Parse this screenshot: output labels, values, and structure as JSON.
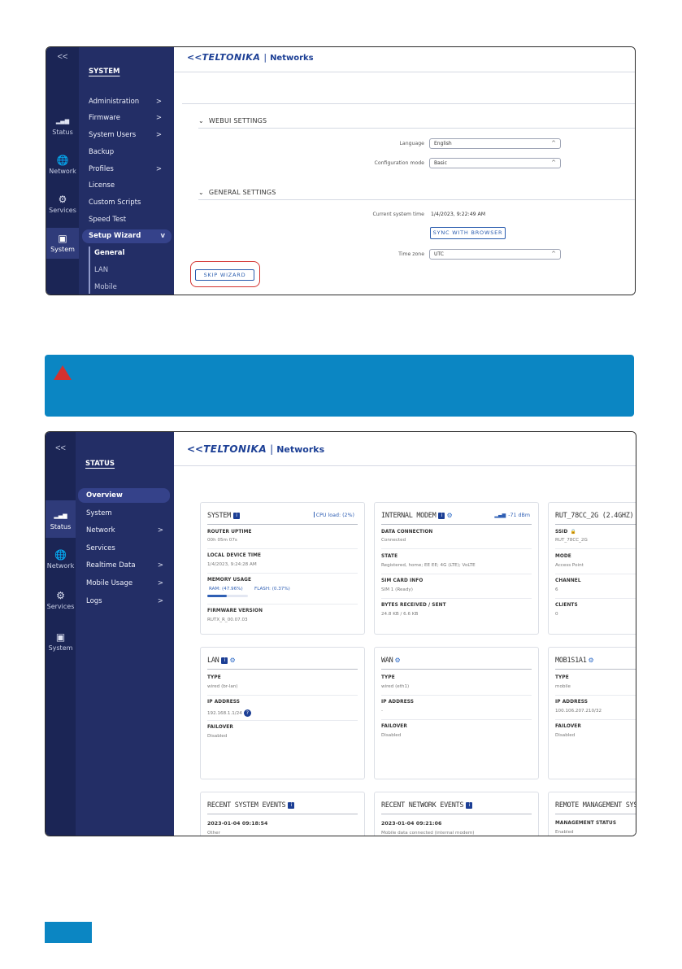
{
  "wizard": {
    "collapse": "<<",
    "icon_sidebar": [
      {
        "label": "Status",
        "icon": "signal-icon",
        "glyph": "▂▄▆"
      },
      {
        "label": "Network",
        "icon": "globe-icon",
        "glyph": "🌐"
      },
      {
        "label": "Services",
        "icon": "gear-icon",
        "glyph": "⚙"
      },
      {
        "label": "System",
        "icon": "system-icon",
        "glyph": "▣"
      }
    ],
    "nav_title": "SYSTEM",
    "nav_items": [
      {
        "label": "Administration",
        "has_arrow": true
      },
      {
        "label": "Firmware",
        "has_arrow": true
      },
      {
        "label": "System Users",
        "has_arrow": true
      },
      {
        "label": "Backup",
        "has_arrow": false
      },
      {
        "label": "Profiles",
        "has_arrow": true
      },
      {
        "label": "License",
        "has_arrow": false
      },
      {
        "label": "Custom Scripts",
        "has_arrow": false
      },
      {
        "label": "Speed Test",
        "has_arrow": false
      },
      {
        "label": "Setup Wizard",
        "has_arrow": true
      }
    ],
    "sub_items": [
      "General",
      "LAN",
      "Mobile"
    ],
    "logo": {
      "brand": "TELTONIKA",
      "sep": "|",
      "product": "Networks"
    },
    "section_webui": "WEBUI SETTINGS",
    "language_label": "Language",
    "language_value": "English",
    "config_label": "Configuration mode",
    "config_value": "Basic",
    "section_general": "GENERAL SETTINGS",
    "time_label": "Current system time",
    "time_value": "1/4/2023, 9:22:49 AM",
    "sync_button": "SYNC WITH BROWSER",
    "tz_label": "Time zone",
    "tz_value": "UTC",
    "skip_button": "SKIP WIZARD",
    "chevron": "⌄",
    "caret": "^",
    "arrow": ">",
    "arrow_down": "v"
  },
  "notice": {
    "color": "#0b86c3",
    "warning_color": "#d3322f"
  },
  "status": {
    "collapse": "<<",
    "icon_sidebar": [
      {
        "label": "Status",
        "icon": "signal-icon",
        "glyph": "▂▄▆"
      },
      {
        "label": "Network",
        "icon": "globe-icon",
        "glyph": "🌐"
      },
      {
        "label": "Services",
        "icon": "gear-icon",
        "glyph": "⚙"
      },
      {
        "label": "System",
        "icon": "system-icon",
        "glyph": "▣"
      }
    ],
    "nav_title": "STATUS",
    "nav_items": [
      {
        "label": "Overview",
        "has_arrow": false
      },
      {
        "label": "System",
        "has_arrow": false
      },
      {
        "label": "Network",
        "has_arrow": true
      },
      {
        "label": "Services",
        "has_arrow": false
      },
      {
        "label": "Realtime Data",
        "has_arrow": true
      },
      {
        "label": "Mobile Usage",
        "has_arrow": true
      },
      {
        "label": "Logs",
        "has_arrow": true
      }
    ],
    "logo": {
      "brand": "TELTONIKA",
      "sep": "|",
      "product": "Networks"
    },
    "cards": {
      "system": {
        "title": "SYSTEM",
        "cpu_load": "CPU load: (2%)",
        "router_uptime_label": "ROUTER UPTIME",
        "router_uptime": "00h 05m 07s",
        "device_time_label": "LOCAL DEVICE TIME",
        "device_time": "1/4/2023, 9:24:28 AM",
        "memory_label": "MEMORY USAGE",
        "ram": "RAM: (47.96%)",
        "flash": "FLASH: (0.37%)",
        "ram_fraction": 0.4796,
        "firmware_label": "FIRMWARE VERSION",
        "firmware": "RUTX_R_00.07.03"
      },
      "modem": {
        "title": "INTERNAL MODEM",
        "signal": "-71 dBm",
        "data_label": "DATA CONNECTION",
        "data": "Connected",
        "state_label": "STATE",
        "state": "Registered, home; EE EE; 4G (LTE); VoLTE",
        "sim_label": "SIM CARD INFO",
        "sim": "SIM 1 (Ready)",
        "bytes_label": "BYTES RECEIVED / SENT",
        "bytes": "24.8 KB / 6.6 KB"
      },
      "wifi": {
        "title": "RUT_78CC_2G (2.4GHZ)",
        "ssid_label": "SSID",
        "ssid": "RUT_78CC_2G",
        "mode_label": "MODE",
        "mode": "Access Point",
        "channel_label": "CHANNEL",
        "channel": "6",
        "clients_label": "CLIENTS",
        "clients": "0"
      },
      "lan": {
        "title": "LAN",
        "type_label": "TYPE",
        "type": "wired (br-lan)",
        "ip_label": "IP ADDRESS",
        "ip": "192.168.1.1/24",
        "failover_label": "FAILOVER",
        "failover": "Disabled"
      },
      "wan": {
        "title": "WAN",
        "type_label": "TYPE",
        "type": "wired (eth1)",
        "ip_label": "IP ADDRESS",
        "ip": "-",
        "failover_label": "FAILOVER",
        "failover": "Disabled"
      },
      "mob": {
        "title": "MOB1S1A1",
        "type_label": "TYPE",
        "type": "mobile",
        "ip_label": "IP ADDRESS",
        "ip": "100.106.207.210/32",
        "failover_label": "FAILOVER",
        "failover": "Disabled"
      },
      "sys_events": {
        "title": "RECENT SYSTEM EVENTS",
        "time": "2023-01-04 09:18:54",
        "desc": "Other"
      },
      "net_events": {
        "title": "RECENT NETWORK EVENTS",
        "time": "2023-01-04 09:21:06",
        "desc": "Mobile data connected (internal modem)"
      },
      "remote": {
        "title": "REMOTE MANAGEMENT SYS",
        "status_label": "MANAGEMENT STATUS",
        "status": "Enabled"
      }
    }
  }
}
